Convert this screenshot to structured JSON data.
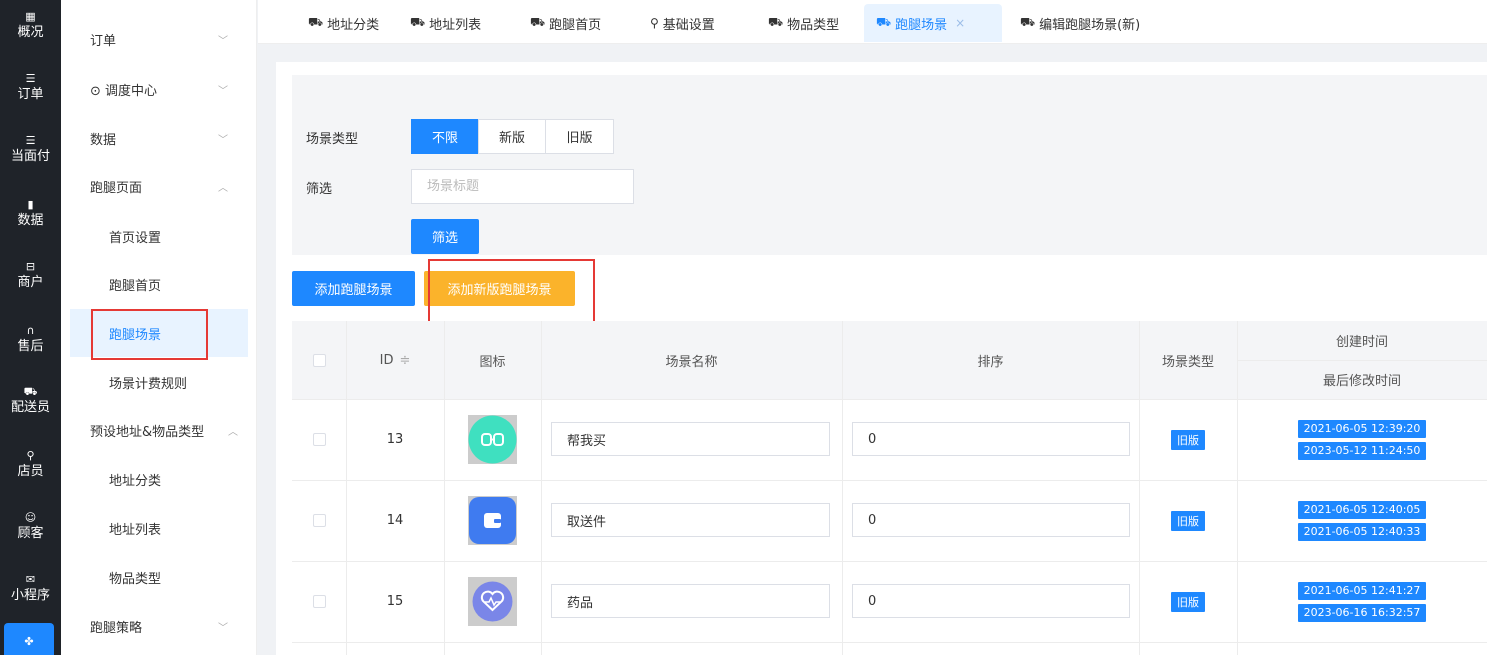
{
  "rail": [
    {
      "icon": "dashboard-icon",
      "glyph": "▦",
      "label": "概况"
    },
    {
      "icon": "list-icon",
      "glyph": "☰",
      "label": "订单"
    },
    {
      "icon": "list-icon",
      "glyph": "☰",
      "label": "当面付"
    },
    {
      "icon": "chart-icon",
      "glyph": "▮",
      "label": "数据"
    },
    {
      "icon": "shop-icon",
      "glyph": "⊟",
      "label": "商户"
    },
    {
      "icon": "headset-icon",
      "glyph": "∩",
      "label": "售后"
    },
    {
      "icon": "courier-icon",
      "glyph": "⛟",
      "label": "配送员"
    },
    {
      "icon": "staff-icon",
      "glyph": "⚲",
      "label": "店员"
    },
    {
      "icon": "customer-icon",
      "glyph": "☺",
      "label": "顾客"
    },
    {
      "icon": "wechat-icon",
      "glyph": "✉",
      "label": "小程序"
    }
  ],
  "menu": [
    {
      "label": "订单",
      "arrow": "﹀",
      "sub": false
    },
    {
      "label": "⊙ 调度中心",
      "arrow": "﹀",
      "sub": false
    },
    {
      "label": "数据",
      "arrow": "﹀",
      "sub": false
    },
    {
      "label": "跑腿页面",
      "arrow": "︿",
      "sub": false
    },
    {
      "label": "首页设置",
      "arrow": "",
      "sub": true
    },
    {
      "label": "跑腿首页",
      "arrow": "",
      "sub": true
    },
    {
      "label": "跑腿场景",
      "arrow": "",
      "sub": true,
      "active": true
    },
    {
      "label": "场景计费规则",
      "arrow": "",
      "sub": true
    },
    {
      "label": "预设地址&物品类型",
      "arrow": "︿",
      "sub": false
    },
    {
      "label": "地址分类",
      "arrow": "",
      "sub": true
    },
    {
      "label": "地址列表",
      "arrow": "",
      "sub": true
    },
    {
      "label": "物品类型",
      "arrow": "",
      "sub": true
    },
    {
      "label": "跑腿策略",
      "arrow": "﹀",
      "sub": false
    }
  ],
  "tabs": [
    {
      "label": "地址分类",
      "glyph": "⛟"
    },
    {
      "label": "地址列表",
      "glyph": "⛟"
    },
    {
      "label": "跑腿首页",
      "glyph": "⛟"
    },
    {
      "label": "基础设置",
      "glyph": "⚲"
    },
    {
      "label": "物品类型",
      "glyph": "⛟"
    },
    {
      "label": "跑腿场景",
      "glyph": "⛟",
      "active": true,
      "close": "×"
    },
    {
      "label": "编辑跑腿场景(新)",
      "glyph": "⛟"
    }
  ],
  "filter": {
    "type_label": "场景类型",
    "type_options": [
      "不限",
      "新版",
      "旧版"
    ],
    "type_selected": "不限",
    "filter_label": "筛选",
    "title_placeholder": "场景标题",
    "filter_button": "筛选"
  },
  "actions": {
    "add_scene": "添加跑腿场景",
    "add_new_scene": "添加新版跑腿场景"
  },
  "table": {
    "headers": {
      "id": "ID",
      "sort_icon": "≑",
      "icon": "图标",
      "name": "场景名称",
      "order": "排序",
      "type": "场景类型",
      "created": "创建时间",
      "modified": "最后修改时间"
    },
    "rows": [
      {
        "id": "13",
        "name": "帮我买",
        "order": "0",
        "type": "旧版",
        "created": "2021-06-05 12:39:20",
        "modified": "2023-05-12 11:24:50",
        "icon_color": "#3fe0c0",
        "icon_glyph": "⊡⊡"
      },
      {
        "id": "14",
        "name": "取送件",
        "order": "0",
        "type": "旧版",
        "created": "2021-06-05 12:40:05",
        "modified": "2021-06-05 12:40:33",
        "icon_color": "#3f7bf0",
        "icon_glyph": "▰"
      },
      {
        "id": "15",
        "name": "药品",
        "order": "0",
        "type": "旧版",
        "created": "2021-06-05 12:41:27",
        "modified": "2023-06-16 16:32:57",
        "icon_color": "#7a86e8",
        "icon_glyph": "♡"
      }
    ]
  },
  "colors": {
    "primary": "#1e88ff",
    "orange": "#fbb32b",
    "highlight": "#e53935",
    "rail_bg": "#1f2329"
  }
}
